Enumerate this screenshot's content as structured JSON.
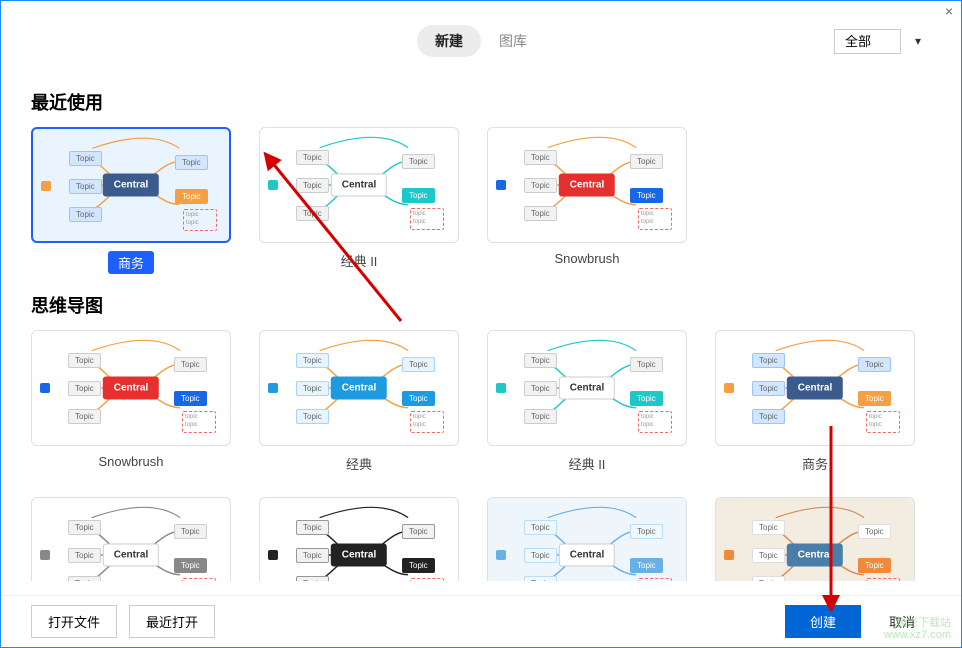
{
  "titlebar": {
    "close_symbol": "×"
  },
  "header": {
    "tabs": [
      {
        "label": "新建",
        "active": true
      },
      {
        "label": "图库",
        "active": false
      }
    ],
    "filter": {
      "selected": "全部"
    }
  },
  "sections": {
    "recent": {
      "title": "最近使用",
      "items": [
        {
          "label": "商务",
          "selected": true,
          "style": "blue"
        },
        {
          "label": "经典 II",
          "selected": false,
          "style": "teal"
        },
        {
          "label": "Snowbrush",
          "selected": false,
          "style": "red"
        }
      ]
    },
    "mindmap": {
      "title": "思维导图",
      "items": [
        {
          "label": "Snowbrush",
          "style": "red"
        },
        {
          "label": "经典",
          "style": "teal2"
        },
        {
          "label": "经典 II",
          "style": "teal"
        },
        {
          "label": "商务",
          "style": "blue"
        },
        {
          "label": "",
          "style": "plain"
        },
        {
          "label": "",
          "style": "dark"
        },
        {
          "label": "",
          "style": "soft"
        },
        {
          "label": "",
          "style": "beige"
        }
      ]
    }
  },
  "preview_text": {
    "central": "Central",
    "topic": "Topic"
  },
  "footer": {
    "open_file": "打开文件",
    "recent_open": "最近打开",
    "create": "创建",
    "cancel": "取消"
  },
  "watermark": {
    "line1": "极光下载站",
    "line2": "www.xz7.com"
  },
  "styles": {
    "blue": {
      "central_bg": "#3b5b8c",
      "central_fg": "#fff",
      "accent": "#f59e42",
      "topic_bg": "#d3e6ff",
      "topic_border": "#9cc3ff",
      "line": "#f59e42"
    },
    "teal": {
      "central_bg": "#ffffff",
      "central_fg": "#333",
      "accent": "#1ec8c8",
      "topic_bg": "#f2f2f2",
      "topic_border": "#ccc",
      "line": "#1ec8c8"
    },
    "teal2": {
      "central_bg": "#1e9be0",
      "central_fg": "#fff",
      "accent": "#1e9be0",
      "topic_bg": "#e8f4ff",
      "topic_border": "#a6d3ff",
      "line": "#f2a23a"
    },
    "red": {
      "central_bg": "#e6302f",
      "central_fg": "#fff",
      "accent": "#1668e6",
      "topic_bg": "#f2f2f2",
      "topic_border": "#ccc",
      "line": "#f2a23a"
    },
    "plain": {
      "central_bg": "#ffffff",
      "central_fg": "#333",
      "accent": "#888",
      "topic_bg": "#f2f2f2",
      "topic_border": "#ccc",
      "line": "#888"
    },
    "dark": {
      "central_bg": "#222",
      "central_fg": "#fff",
      "accent": "#222",
      "topic_bg": "#f2f2f2",
      "topic_border": "#999",
      "line": "#222"
    },
    "soft": {
      "central_bg": "#ffffff",
      "central_fg": "#333",
      "accent": "#67b0e8",
      "topic_bg": "#eef8ff",
      "topic_border": "#bdddf5",
      "line": "#67b0e8",
      "card_bg": "#eef6fc"
    },
    "beige": {
      "central_bg": "#4a7da8",
      "central_fg": "#fff",
      "accent": "#f08a3a",
      "topic_bg": "#ffffff",
      "topic_border": "#ddd",
      "line": "#d88a55",
      "card_bg": "#f3ece0"
    }
  }
}
